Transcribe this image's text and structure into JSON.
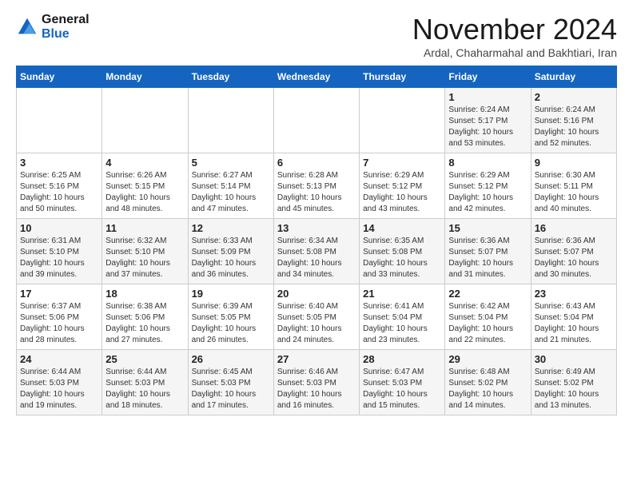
{
  "header": {
    "logo_line1": "General",
    "logo_line2": "Blue",
    "month": "November 2024",
    "location": "Ardal, Chaharmahal and Bakhtiari, Iran"
  },
  "weekdays": [
    "Sunday",
    "Monday",
    "Tuesday",
    "Wednesday",
    "Thursday",
    "Friday",
    "Saturday"
  ],
  "weeks": [
    [
      {
        "day": "",
        "info": ""
      },
      {
        "day": "",
        "info": ""
      },
      {
        "day": "",
        "info": ""
      },
      {
        "day": "",
        "info": ""
      },
      {
        "day": "",
        "info": ""
      },
      {
        "day": "1",
        "info": "Sunrise: 6:24 AM\nSunset: 5:17 PM\nDaylight: 10 hours and 53 minutes."
      },
      {
        "day": "2",
        "info": "Sunrise: 6:24 AM\nSunset: 5:16 PM\nDaylight: 10 hours and 52 minutes."
      }
    ],
    [
      {
        "day": "3",
        "info": "Sunrise: 6:25 AM\nSunset: 5:16 PM\nDaylight: 10 hours and 50 minutes."
      },
      {
        "day": "4",
        "info": "Sunrise: 6:26 AM\nSunset: 5:15 PM\nDaylight: 10 hours and 48 minutes."
      },
      {
        "day": "5",
        "info": "Sunrise: 6:27 AM\nSunset: 5:14 PM\nDaylight: 10 hours and 47 minutes."
      },
      {
        "day": "6",
        "info": "Sunrise: 6:28 AM\nSunset: 5:13 PM\nDaylight: 10 hours and 45 minutes."
      },
      {
        "day": "7",
        "info": "Sunrise: 6:29 AM\nSunset: 5:12 PM\nDaylight: 10 hours and 43 minutes."
      },
      {
        "day": "8",
        "info": "Sunrise: 6:29 AM\nSunset: 5:12 PM\nDaylight: 10 hours and 42 minutes."
      },
      {
        "day": "9",
        "info": "Sunrise: 6:30 AM\nSunset: 5:11 PM\nDaylight: 10 hours and 40 minutes."
      }
    ],
    [
      {
        "day": "10",
        "info": "Sunrise: 6:31 AM\nSunset: 5:10 PM\nDaylight: 10 hours and 39 minutes."
      },
      {
        "day": "11",
        "info": "Sunrise: 6:32 AM\nSunset: 5:10 PM\nDaylight: 10 hours and 37 minutes."
      },
      {
        "day": "12",
        "info": "Sunrise: 6:33 AM\nSunset: 5:09 PM\nDaylight: 10 hours and 36 minutes."
      },
      {
        "day": "13",
        "info": "Sunrise: 6:34 AM\nSunset: 5:08 PM\nDaylight: 10 hours and 34 minutes."
      },
      {
        "day": "14",
        "info": "Sunrise: 6:35 AM\nSunset: 5:08 PM\nDaylight: 10 hours and 33 minutes."
      },
      {
        "day": "15",
        "info": "Sunrise: 6:36 AM\nSunset: 5:07 PM\nDaylight: 10 hours and 31 minutes."
      },
      {
        "day": "16",
        "info": "Sunrise: 6:36 AM\nSunset: 5:07 PM\nDaylight: 10 hours and 30 minutes."
      }
    ],
    [
      {
        "day": "17",
        "info": "Sunrise: 6:37 AM\nSunset: 5:06 PM\nDaylight: 10 hours and 28 minutes."
      },
      {
        "day": "18",
        "info": "Sunrise: 6:38 AM\nSunset: 5:06 PM\nDaylight: 10 hours and 27 minutes."
      },
      {
        "day": "19",
        "info": "Sunrise: 6:39 AM\nSunset: 5:05 PM\nDaylight: 10 hours and 26 minutes."
      },
      {
        "day": "20",
        "info": "Sunrise: 6:40 AM\nSunset: 5:05 PM\nDaylight: 10 hours and 24 minutes."
      },
      {
        "day": "21",
        "info": "Sunrise: 6:41 AM\nSunset: 5:04 PM\nDaylight: 10 hours and 23 minutes."
      },
      {
        "day": "22",
        "info": "Sunrise: 6:42 AM\nSunset: 5:04 PM\nDaylight: 10 hours and 22 minutes."
      },
      {
        "day": "23",
        "info": "Sunrise: 6:43 AM\nSunset: 5:04 PM\nDaylight: 10 hours and 21 minutes."
      }
    ],
    [
      {
        "day": "24",
        "info": "Sunrise: 6:44 AM\nSunset: 5:03 PM\nDaylight: 10 hours and 19 minutes."
      },
      {
        "day": "25",
        "info": "Sunrise: 6:44 AM\nSunset: 5:03 PM\nDaylight: 10 hours and 18 minutes."
      },
      {
        "day": "26",
        "info": "Sunrise: 6:45 AM\nSunset: 5:03 PM\nDaylight: 10 hours and 17 minutes."
      },
      {
        "day": "27",
        "info": "Sunrise: 6:46 AM\nSunset: 5:03 PM\nDaylight: 10 hours and 16 minutes."
      },
      {
        "day": "28",
        "info": "Sunrise: 6:47 AM\nSunset: 5:03 PM\nDaylight: 10 hours and 15 minutes."
      },
      {
        "day": "29",
        "info": "Sunrise: 6:48 AM\nSunset: 5:02 PM\nDaylight: 10 hours and 14 minutes."
      },
      {
        "day": "30",
        "info": "Sunrise: 6:49 AM\nSunset: 5:02 PM\nDaylight: 10 hours and 13 minutes."
      }
    ]
  ]
}
